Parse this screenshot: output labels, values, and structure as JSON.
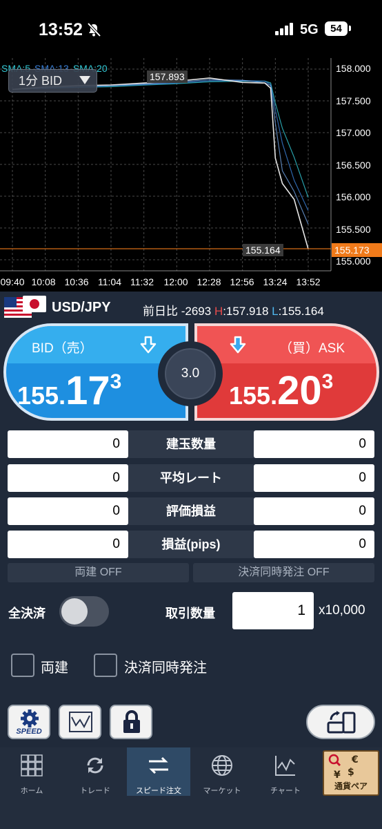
{
  "status_bar": {
    "time": "13:52",
    "network": "5G",
    "battery": "54"
  },
  "chart": {
    "sma_labels": [
      {
        "text": "SMA:5",
        "color": "#33c9d6"
      },
      {
        "text": "SMA:13",
        "color": "#3a7fd6"
      },
      {
        "text": "SMA:20",
        "color": "#33c9d6"
      }
    ],
    "timeframe": "1分 BID",
    "y_ticks": [
      "158.000",
      "157.500",
      "157.000",
      "156.500",
      "156.000",
      "155.500",
      "155.000"
    ],
    "x_ticks": [
      "09:40",
      "10:08",
      "10:36",
      "11:04",
      "11:32",
      "12:00",
      "12:28",
      "12:56",
      "13:24",
      "13:52"
    ],
    "high_label": "157.893",
    "low_label": "155.164",
    "current_label": "155.173",
    "accent_current": "#f07a1a"
  },
  "chart_data": {
    "type": "line",
    "title": "",
    "xlabel": "",
    "ylabel": "",
    "x": [
      "09:40",
      "10:08",
      "10:36",
      "11:04",
      "11:32",
      "12:00",
      "12:28",
      "12:56",
      "13:15",
      "13:20",
      "13:24",
      "13:30",
      "13:40",
      "13:52"
    ],
    "series": [
      {
        "name": "BID",
        "values": [
          157.68,
          157.72,
          157.74,
          157.75,
          157.78,
          157.81,
          157.86,
          157.79,
          157.78,
          157.7,
          156.6,
          156.2,
          155.95,
          155.17
        ]
      }
    ],
    "ylim": [
      155.0,
      158.0
    ],
    "grid": true
  },
  "pair": {
    "name": "USD/JPY",
    "change_label": "前日比",
    "change_value": "-2693",
    "high_prefix": "H",
    "high_value": "157.918",
    "low_prefix": "L",
    "low_value": "155.164"
  },
  "bid": {
    "label": "BID（売）",
    "price_a": "155.",
    "price_b": "17",
    "price_c": "3",
    "color": "#1e8fe0"
  },
  "ask": {
    "label": "（買）ASK",
    "price_a": "155.",
    "price_b": "20",
    "price_c": "3",
    "color": "#e03a3a"
  },
  "spread": "3.0",
  "rows": [
    {
      "label": "建玉数量",
      "left": "0",
      "right": "0"
    },
    {
      "label": "平均レート",
      "left": "0",
      "right": "0"
    },
    {
      "label": "評価損益",
      "left": "0",
      "right": "0"
    },
    {
      "label": "損益(pips)",
      "left": "0",
      "right": "0"
    }
  ],
  "toggles": {
    "both": "両建 OFF",
    "simultaneous": "決済同時発注 OFF"
  },
  "close_all_label": "全決済",
  "qty": {
    "label": "取引数量",
    "value": "1",
    "unit": "x10,000"
  },
  "checkboxes": [
    {
      "label": "両建"
    },
    {
      "label": "決済同時発注"
    }
  ],
  "speed_icon_text": "SPEED",
  "tabs": [
    {
      "label": "ホーム",
      "icon": "grid-icon"
    },
    {
      "label": "トレード",
      "icon": "arrows-cycle-icon"
    },
    {
      "label": "スピード注文",
      "icon": "speed-arrows-icon",
      "active": true
    },
    {
      "label": "マーケット",
      "icon": "globe-icon"
    },
    {
      "label": "チャート",
      "icon": "chart-icon"
    },
    {
      "label": "通貨ペア",
      "icon": "currency-icon"
    }
  ]
}
